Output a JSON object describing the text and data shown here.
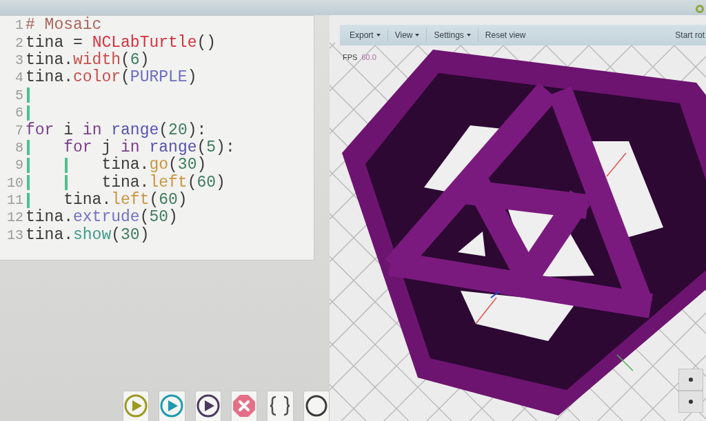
{
  "editor": {
    "lines": [
      {
        "number": "1",
        "tokens": [
          {
            "kind": "comment",
            "text": "# Mosaic"
          }
        ]
      },
      {
        "number": "2",
        "tokens": [
          {
            "kind": "text",
            "text": "tina = "
          },
          {
            "kind": "class",
            "text": "NCLabTurtle"
          },
          {
            "kind": "text",
            "text": "()"
          }
        ]
      },
      {
        "number": "3",
        "tokens": [
          {
            "kind": "text",
            "text": "tina."
          },
          {
            "kind": "attr",
            "text": "width"
          },
          {
            "kind": "text",
            "text": "("
          },
          {
            "kind": "number",
            "text": "6"
          },
          {
            "kind": "text",
            "text": ")"
          }
        ]
      },
      {
        "number": "4",
        "tokens": [
          {
            "kind": "text",
            "text": "tina."
          },
          {
            "kind": "attr",
            "text": "color"
          },
          {
            "kind": "text",
            "text": "("
          },
          {
            "kind": "constant",
            "text": "PURPLE"
          },
          {
            "kind": "text",
            "text": ")"
          }
        ]
      },
      {
        "number": "5",
        "indent": [
          {
            "guide": true
          }
        ]
      },
      {
        "number": "6",
        "indent": [
          {
            "guide": true
          }
        ]
      },
      {
        "number": "7",
        "tokens": [
          {
            "kind": "keyword",
            "text": "for"
          },
          {
            "kind": "text",
            "text": " i "
          },
          {
            "kind": "keyword",
            "text": "in "
          },
          {
            "kind": "builtin",
            "text": "range"
          },
          {
            "kind": "text",
            "text": "("
          },
          {
            "kind": "number",
            "text": "20"
          },
          {
            "kind": "text",
            "text": "):"
          }
        ]
      },
      {
        "number": "8",
        "indent": [
          {
            "guide": true
          }
        ],
        "tokens": [
          {
            "kind": "keyword",
            "text": "for"
          },
          {
            "kind": "text",
            "text": " j "
          },
          {
            "kind": "keyword",
            "text": "in "
          },
          {
            "kind": "builtin",
            "text": "range"
          },
          {
            "kind": "text",
            "text": "("
          },
          {
            "kind": "number",
            "text": "5"
          },
          {
            "kind": "text",
            "text": "):"
          }
        ]
      },
      {
        "number": "9",
        "indent": [
          {
            "guide": true
          },
          {
            "guide": true
          }
        ],
        "tokens": [
          {
            "kind": "text",
            "text": "tina."
          },
          {
            "kind": "motion",
            "text": "go"
          },
          {
            "kind": "text",
            "text": "("
          },
          {
            "kind": "number",
            "text": "30"
          },
          {
            "kind": "text",
            "text": ")"
          }
        ]
      },
      {
        "number": "10",
        "indent": [
          {
            "guide": true
          },
          {
            "guide": true
          }
        ],
        "tokens": [
          {
            "kind": "text",
            "text": "tina."
          },
          {
            "kind": "motion",
            "text": "left"
          },
          {
            "kind": "text",
            "text": "("
          },
          {
            "kind": "number",
            "text": "60"
          },
          {
            "kind": "text",
            "text": ")"
          }
        ]
      },
      {
        "number": "11",
        "indent": [
          {
            "guide": true
          }
        ],
        "tokens": [
          {
            "kind": "text",
            "text": "tina."
          },
          {
            "kind": "motion",
            "text": "left"
          },
          {
            "kind": "text",
            "text": "("
          },
          {
            "kind": "number",
            "text": "60"
          },
          {
            "kind": "text",
            "text": ")"
          }
        ]
      },
      {
        "number": "12",
        "tokens": [
          {
            "kind": "text",
            "text": "tina."
          },
          {
            "kind": "geometry",
            "text": "extrude"
          },
          {
            "kind": "text",
            "text": "("
          },
          {
            "kind": "number",
            "text": "50"
          },
          {
            "kind": "text",
            "text": ")"
          }
        ]
      },
      {
        "number": "13",
        "tokens": [
          {
            "kind": "text",
            "text": "tina."
          },
          {
            "kind": "output",
            "text": "show"
          },
          {
            "kind": "text",
            "text": "("
          },
          {
            "kind": "number",
            "text": "30"
          },
          {
            "kind": "text",
            "text": ")"
          }
        ]
      }
    ]
  },
  "run_buttons": [
    {
      "kind": "play",
      "color": "#9c9a1e"
    },
    {
      "kind": "play",
      "color": "#1e9ab0"
    },
    {
      "kind": "play",
      "color": "#4b3a5e"
    },
    {
      "kind": "stop"
    },
    {
      "kind": "brackets"
    },
    {
      "kind": "ring"
    }
  ],
  "viewport": {
    "toolbar": [
      {
        "label": "Export",
        "dropdown": true
      },
      {
        "label": "View",
        "dropdown": true
      },
      {
        "label": "Settings",
        "dropdown": true
      },
      {
        "label": "Reset view",
        "dropdown": false
      },
      {
        "label": "Start rot",
        "dropdown": false
      }
    ],
    "fps": {
      "label": "FPS",
      "value": "60.0"
    }
  }
}
